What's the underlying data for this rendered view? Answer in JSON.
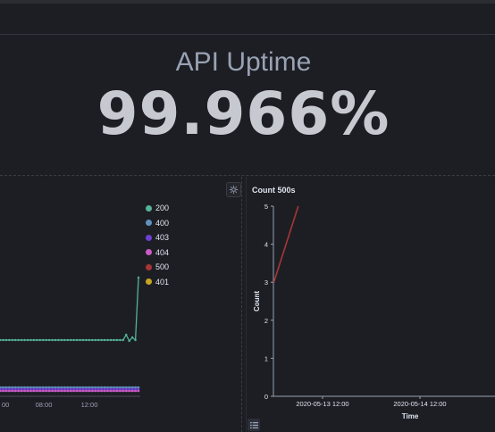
{
  "metric": {
    "title": "API Uptime",
    "value": "99.966%"
  },
  "status_chart": {
    "legend": [
      {
        "label": "200",
        "color": "#54b399"
      },
      {
        "label": "400",
        "color": "#6092c0"
      },
      {
        "label": "403",
        "color": "#6f3fd3"
      },
      {
        "label": "404",
        "color": "#ca5bc6"
      },
      {
        "label": "500",
        "color": "#a73636"
      },
      {
        "label": "401",
        "color": "#c6a523"
      }
    ],
    "x_ticks": [
      "00",
      "08:00",
      "12:00"
    ]
  },
  "chart_data": {
    "type": "line",
    "title": "Count 500s",
    "xlabel": "Time",
    "ylabel": "Count",
    "ylim": [
      0,
      5
    ],
    "y_ticks": [
      0,
      1,
      2,
      3,
      4,
      5
    ],
    "x_ticks": [
      "2020-05-13 12:00",
      "2020-05-14 12:00"
    ],
    "series": [
      {
        "color": "#a73636",
        "x": [
          "2020-05-13 00:00",
          "2020-05-13 06:00"
        ],
        "values": [
          3,
          5
        ]
      }
    ]
  }
}
